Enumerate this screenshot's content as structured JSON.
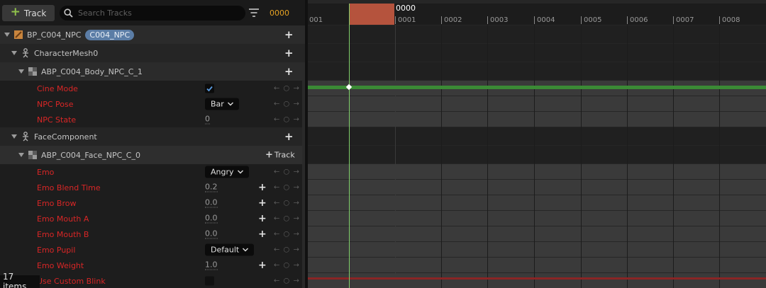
{
  "toolbar": {
    "add_track_label": "Track",
    "search_placeholder": "Search Tracks",
    "frame_value": "0000"
  },
  "tree": [
    {
      "kind": "object",
      "label": "BP_C004_NPC",
      "tag": "C004_NPC",
      "action": "+",
      "icon": "blueprint-icon"
    },
    {
      "kind": "object",
      "label": "CharacterMesh0",
      "action": "+",
      "icon": "skeletal-mesh-icon"
    },
    {
      "kind": "object",
      "label": "ABP_C004_Body_NPC_C_1",
      "action": "+",
      "icon": "anim-blueprint-icon"
    },
    {
      "kind": "property",
      "label": "Cine Mode",
      "editor": "checkbox",
      "checked": true
    },
    {
      "kind": "property",
      "label": "NPC Pose",
      "editor": "dropdown",
      "value": "Bar"
    },
    {
      "kind": "property",
      "label": "NPC State",
      "editor": "number",
      "value": "0"
    },
    {
      "kind": "object",
      "label": "FaceComponent",
      "action": "+",
      "icon": "skeletal-mesh-icon"
    },
    {
      "kind": "object",
      "label": "ABP_C004_Face_NPC_C_0",
      "action": "+ Track",
      "icon": "anim-blueprint-icon"
    },
    {
      "kind": "property",
      "label": "Emo",
      "editor": "dropdown",
      "value": "Angry"
    },
    {
      "kind": "property",
      "label": "Emo Blend Time",
      "editor": "number",
      "value": "0.2"
    },
    {
      "kind": "property",
      "label": "Emo Brow",
      "editor": "number",
      "value": "0.0"
    },
    {
      "kind": "property",
      "label": "Emo Mouth A",
      "editor": "number",
      "value": "0.0"
    },
    {
      "kind": "property",
      "label": "Emo Mouth B",
      "editor": "number",
      "value": "0.0"
    },
    {
      "kind": "property",
      "label": "Emo Pupil",
      "editor": "dropdown",
      "value": "Default"
    },
    {
      "kind": "property",
      "label": "Emo Weight",
      "editor": "number",
      "value": "1.0"
    },
    {
      "kind": "property",
      "label": "Use Custom Blink",
      "editor": "checkbox",
      "checked": false
    }
  ],
  "keyframe_nav": "← ○ →",
  "status": {
    "items_label": "17 items"
  },
  "timeline": {
    "current_frame": "0000",
    "ticks": [
      "001",
      "0001",
      "0002",
      "0003",
      "0004",
      "0005",
      "0006",
      "0007",
      "0008"
    ]
  },
  "colors": {
    "property_label": "#d92626",
    "frame_field": "#e6a222",
    "playhead": "#b5533d",
    "tag": "#5b7da6",
    "cine_track": "#3b8a35"
  }
}
